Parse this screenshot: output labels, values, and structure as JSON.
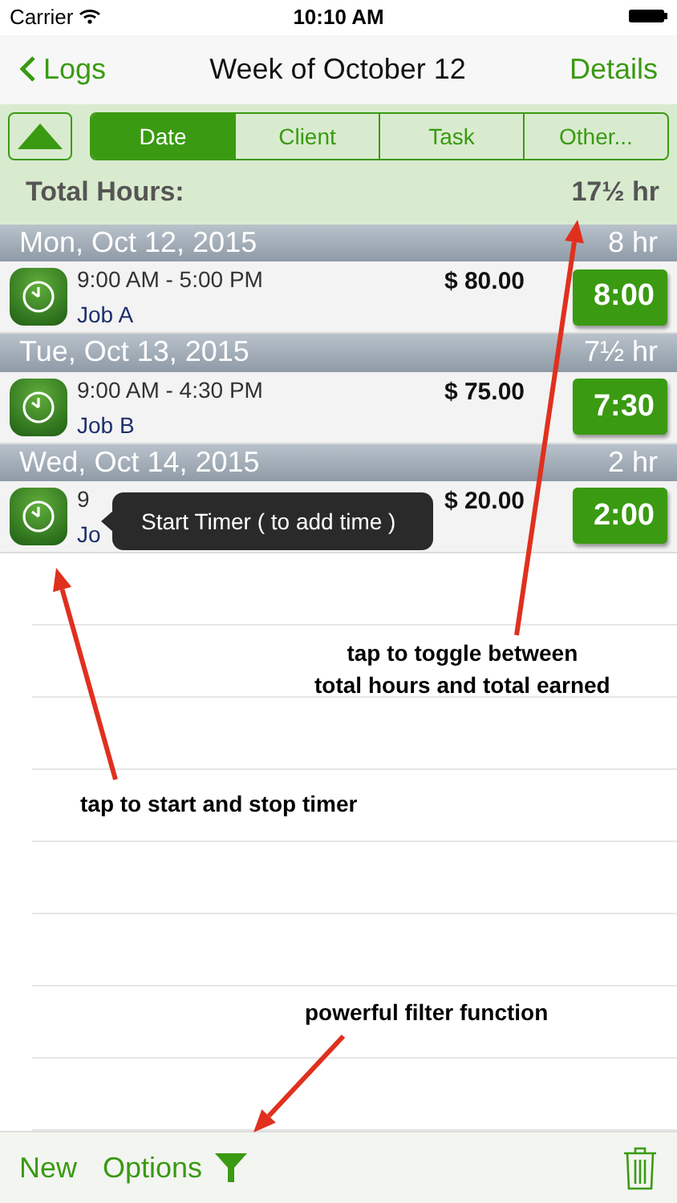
{
  "status_bar": {
    "carrier": "Carrier",
    "time": "10:10 AM"
  },
  "nav": {
    "back": "Logs",
    "title": "Week of October 12",
    "action": "Details"
  },
  "segments": [
    {
      "label": "Date",
      "selected": true
    },
    {
      "label": "Client",
      "selected": false
    },
    {
      "label": "Task",
      "selected": false
    },
    {
      "label": "Other...",
      "selected": false
    }
  ],
  "total": {
    "label": "Total Hours:",
    "value": "17½ hr"
  },
  "days": [
    {
      "date": "Mon, Oct 12, 2015",
      "hours": "8 hr",
      "entries": [
        {
          "time": "9:00 AM - 5:00 PM",
          "job": "Job A",
          "amount": "$ 80.00",
          "duration": "8:00"
        }
      ]
    },
    {
      "date": "Tue, Oct 13, 2015",
      "hours": "7½ hr",
      "entries": [
        {
          "time": "9:00 AM - 4:30 PM",
          "job": "Job B",
          "amount": "$ 75.00",
          "duration": "7:30"
        }
      ]
    },
    {
      "date": "Wed, Oct 14, 2015",
      "hours": "2 hr",
      "entries": [
        {
          "time": "9",
          "job": "Jo",
          "amount": "$ 20.00",
          "duration": "2:00"
        }
      ]
    }
  ],
  "tooltip": "Start Timer ( to add time )",
  "annotations": [
    {
      "lines": [
        "tap to toggle between",
        "total hours and total earned"
      ]
    },
    {
      "lines": [
        "tap to start and stop timer"
      ]
    },
    {
      "lines": [
        "powerful filter function"
      ]
    }
  ],
  "toolbar": {
    "new": "New",
    "options": "Options"
  }
}
